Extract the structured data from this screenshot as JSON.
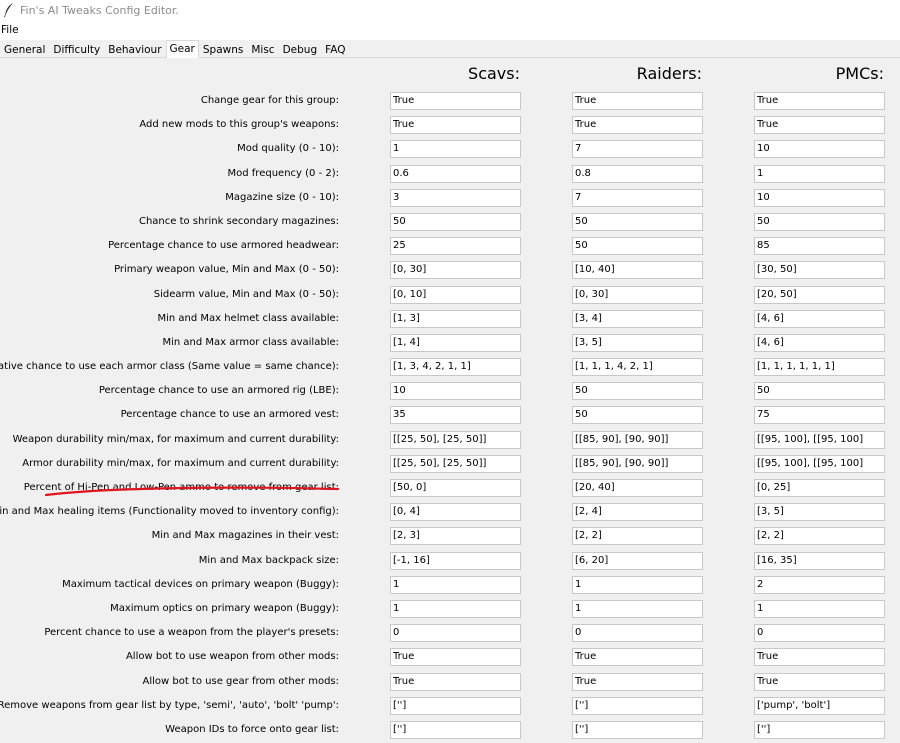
{
  "window": {
    "title": "Fin's AI Tweaks Config Editor."
  },
  "menu": {
    "items": [
      "File"
    ]
  },
  "tabs": [
    "General",
    "Difficulty",
    "Behaviour",
    "Gear",
    "Spawns",
    "Misc",
    "Debug",
    "FAQ"
  ],
  "active_tab": "Gear",
  "columns": [
    "Scavs:",
    "Raiders:",
    "PMCs:"
  ],
  "rows": [
    {
      "label": "Change gear for this group:",
      "values": [
        "True",
        "True",
        "True"
      ]
    },
    {
      "label": "Add new mods to this group's weapons:",
      "values": [
        "True",
        "True",
        "True"
      ]
    },
    {
      "label": "Mod quality (0 - 10):",
      "values": [
        "1",
        "7",
        "10"
      ]
    },
    {
      "label": "Mod frequency (0 - 2):",
      "values": [
        "0.6",
        "0.8",
        "1"
      ]
    },
    {
      "label": "Magazine size (0 - 10):",
      "values": [
        "3",
        "7",
        "10"
      ]
    },
    {
      "label": "Chance to shrink secondary magazines:",
      "values": [
        "50",
        "50",
        "50"
      ]
    },
    {
      "label": "Percentage chance to use armored headwear:",
      "values": [
        "25",
        "50",
        "85"
      ]
    },
    {
      "label": "Primary weapon value, Min and Max (0 - 50):",
      "values": [
        "[0, 30]",
        "[10, 40]",
        "[30, 50]"
      ]
    },
    {
      "label": "Sidearm value, Min and Max (0 - 50):",
      "values": [
        "[0, 10]",
        "[0, 30]",
        "[20, 50]"
      ]
    },
    {
      "label": "Min and Max helmet class available:",
      "values": [
        "[1, 3]",
        "[3, 4]",
        "[4, 6]"
      ]
    },
    {
      "label": "Min and Max armor class available:",
      "values": [
        "[1, 4]",
        "[3, 5]",
        "[4, 6]"
      ]
    },
    {
      "label": "Relative chance to use each armor class (Same value = same chance):",
      "values": [
        "[1, 3, 4, 2, 1, 1]",
        "[1, 1, 1, 4, 2, 1]",
        "[1, 1, 1, 1, 1, 1]"
      ]
    },
    {
      "label": "Percentage chance to use an armored rig (LBE):",
      "values": [
        "10",
        "50",
        "50"
      ]
    },
    {
      "label": "Percentage chance to use an armored vest:",
      "values": [
        "35",
        "50",
        "75"
      ]
    },
    {
      "label": "Weapon durability min/max, for maximum and current durability:",
      "values": [
        "[[25, 50], [25, 50]]",
        "[[85, 90], [90, 90]]",
        "[[95, 100], [[95, 100]"
      ]
    },
    {
      "label": "Armor durability min/max, for maximum and current durability:",
      "values": [
        "[[25, 50], [25, 50]]",
        "[[85, 90], [90, 90]]",
        "[[95, 100], [[95, 100]"
      ]
    },
    {
      "label": "Percent of Hi-Pen and Low-Pen ammo to remove from gear list:",
      "values": [
        "[50, 0]",
        "[20, 40]",
        "[0, 25]"
      ]
    },
    {
      "label": "Min and Max healing items (Functionality moved to inventory config):",
      "values": [
        "[0, 4]",
        "[2, 4]",
        "[3, 5]"
      ]
    },
    {
      "label": "Min and Max magazines in their vest:",
      "values": [
        "[2, 3]",
        "[2, 2]",
        "[2, 2]"
      ]
    },
    {
      "label": "Min and Max backpack size:",
      "values": [
        "[-1, 16]",
        "[6, 20]",
        "[16, 35]"
      ]
    },
    {
      "label": "Maximum tactical devices on primary weapon (Buggy):",
      "values": [
        "1",
        "1",
        "2"
      ]
    },
    {
      "label": "Maximum optics on primary weapon (Buggy):",
      "values": [
        "1",
        "1",
        "1"
      ]
    },
    {
      "label": "Percent chance to use a weapon from the player's presets:",
      "values": [
        "0",
        "0",
        "0"
      ]
    },
    {
      "label": "Allow bot to use weapon from other mods:",
      "values": [
        "True",
        "True",
        "True"
      ]
    },
    {
      "label": "Allow bot to use gear from other mods:",
      "values": [
        "True",
        "True",
        "True"
      ]
    },
    {
      "label": "Remove weapons from gear list by type, 'semi', 'auto', 'bolt' 'pump':",
      "values": [
        "['']",
        "['']",
        "['pump', 'bolt']"
      ]
    },
    {
      "label": "Weapon IDs to force onto gear list:",
      "values": [
        "['']",
        "['']",
        "['']"
      ]
    }
  ],
  "colors": {
    "annotation": "#e0141e",
    "field_border": "#c8c8c8"
  }
}
